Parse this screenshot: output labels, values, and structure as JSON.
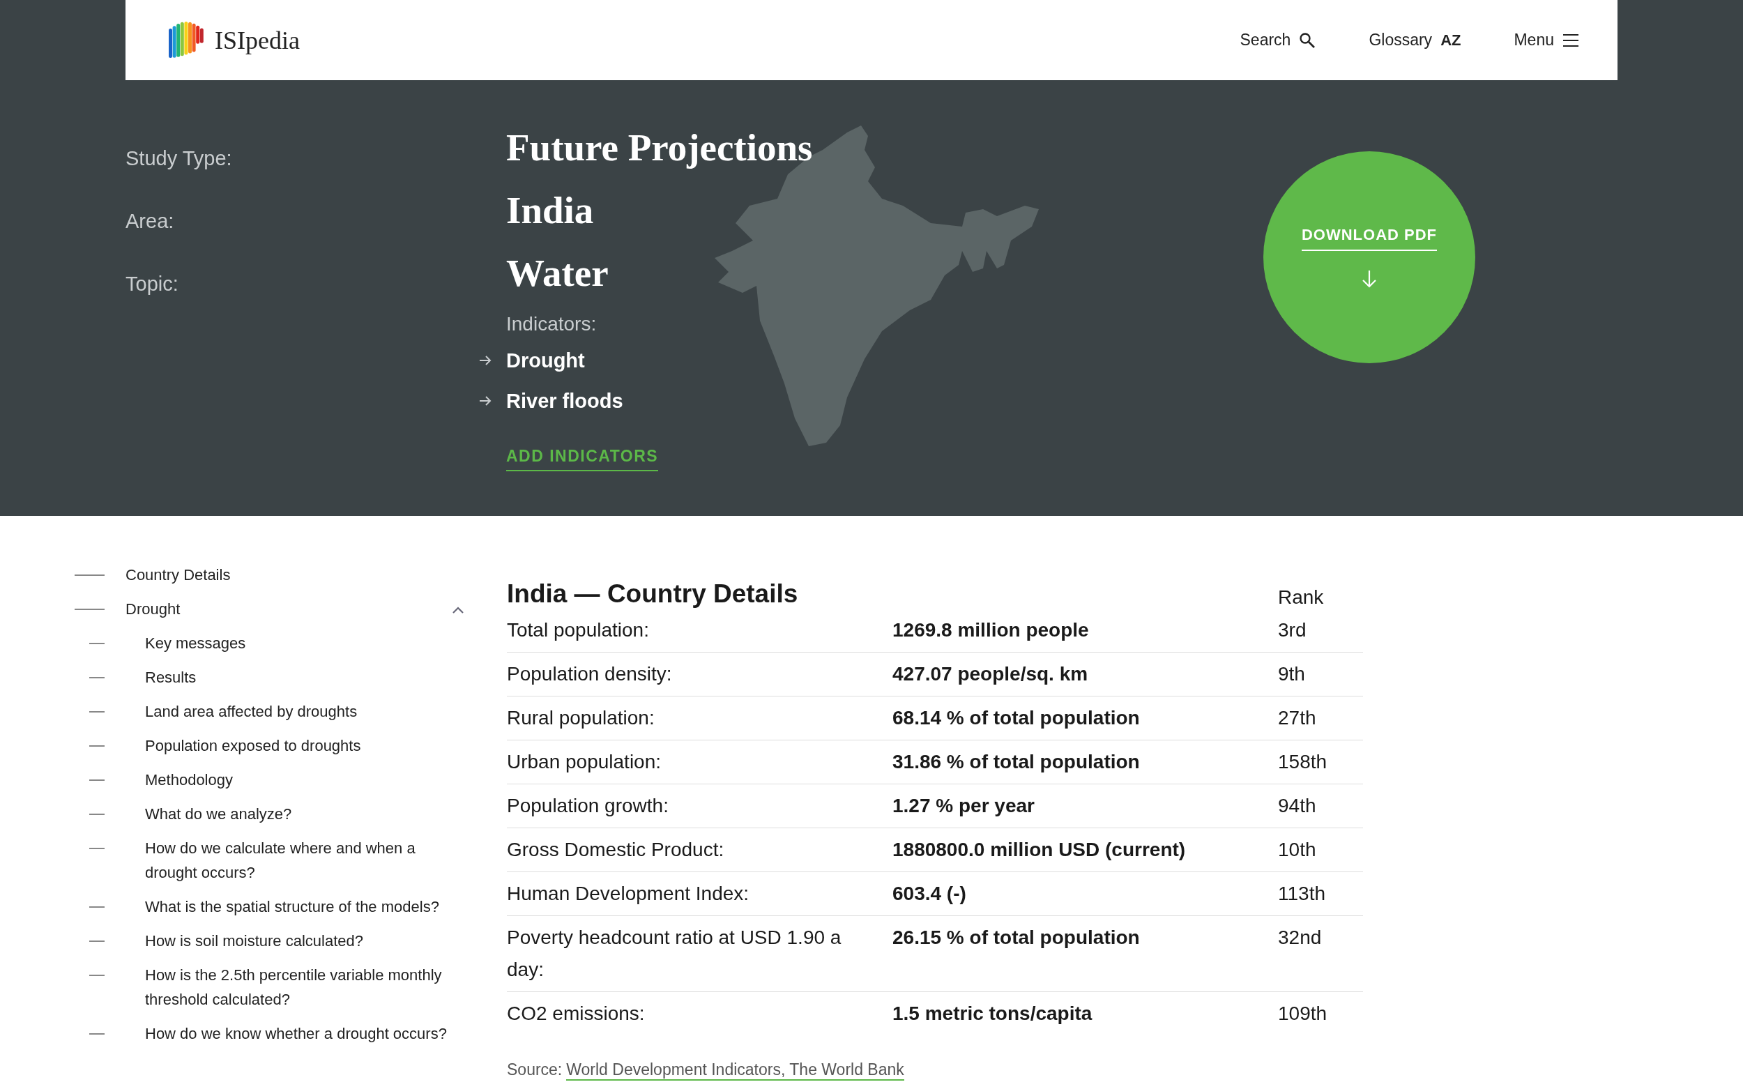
{
  "header": {
    "brand": "ISIpedia",
    "nav": [
      {
        "label": "Search",
        "kind": "search"
      },
      {
        "label": "Glossary",
        "kind": "glossary",
        "icon_text": "AZ"
      },
      {
        "label": "Menu",
        "kind": "menu"
      }
    ]
  },
  "hero": {
    "fields": [
      {
        "label": "Study Type:",
        "value": "Future Projections"
      },
      {
        "label": "Area:",
        "value": "India"
      },
      {
        "label": "Topic:",
        "value": "Water"
      }
    ],
    "indicators_label": "Indicators:",
    "indicators": [
      "Drought",
      "River floods"
    ],
    "add_link": "ADD INDICATORS",
    "download": "DOWNLOAD PDF"
  },
  "sidebar": {
    "items": [
      {
        "label": "Country Details"
      },
      {
        "label": "Drought",
        "expanded": true,
        "children": [
          "Key messages",
          "Results",
          "Land area affected by droughts",
          "Population exposed to droughts",
          "Methodology",
          "What do we analyze?",
          "How do we calculate where and when a drought occurs?",
          "What is the spatial structure of the models?",
          "How is soil moisture calculated?",
          "How is the 2.5th percentile variable monthly threshold calculated?",
          "How do we know whether a drought occurs?"
        ]
      }
    ]
  },
  "table": {
    "title": "India — Country Details",
    "rank_heading": "Rank",
    "rows": [
      [
        "Total population:",
        "1269.8 million people",
        "3rd"
      ],
      [
        "Population density:",
        "427.07 people/sq. km",
        "9th"
      ],
      [
        "Rural population:",
        "68.14 % of total population",
        "27th"
      ],
      [
        "Urban population:",
        "31.86 % of total population",
        "158th"
      ],
      [
        "Population growth:",
        "1.27 % per year",
        "94th"
      ],
      [
        "Gross Domestic Product:",
        "1880800.0 million USD (current)",
        "10th"
      ],
      [
        "Human Development Index:",
        "603.4 (-)",
        "113th"
      ],
      [
        "Poverty headcount ratio at USD 1.90 a day:",
        "26.15 % of total population",
        "32nd"
      ],
      [
        "CO2 emissions:",
        "1.5 metric tons/capita",
        "109th"
      ]
    ],
    "source_label": "Source:",
    "source_link": "World Development Indicators, The World Bank"
  }
}
